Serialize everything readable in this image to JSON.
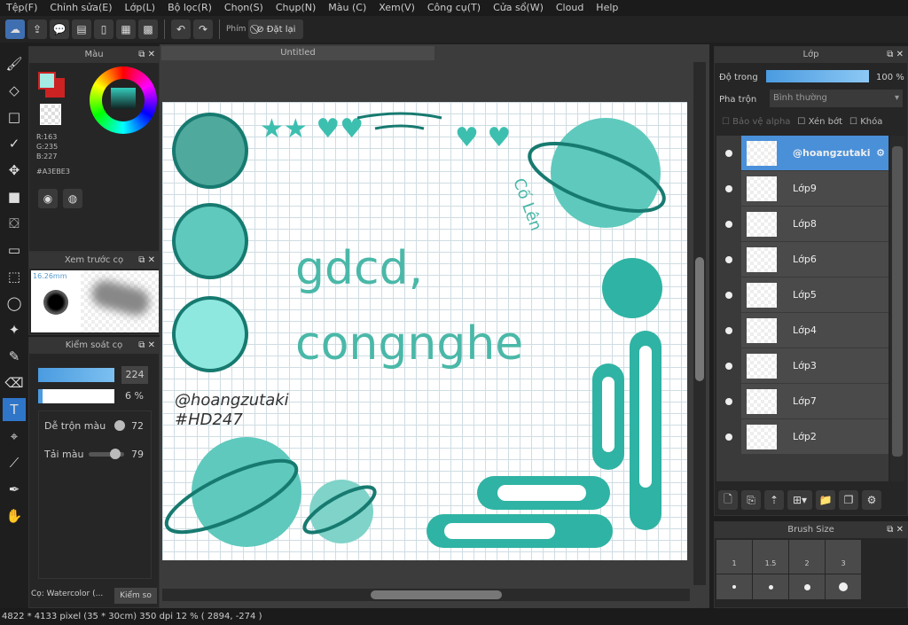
{
  "menu": [
    "Tệp(F)",
    "Chỉnh sửa(E)",
    "Lớp(L)",
    "Bộ lọc(R)",
    "Chọn(S)",
    "Chụp(N)",
    "Màu (C)",
    "Xem(V)",
    "Công cụ(T)",
    "Cửa sổ(W)",
    "Cloud",
    "Help"
  ],
  "toolbar": {
    "shortcut_label": "Phím",
    "reset_label": "Đặt lại"
  },
  "canvas": {
    "title": "Untitled",
    "text1": "gdcd,",
    "text2": "congnghe",
    "watermark1": "@hoangzutaki",
    "watermark2": "#HD247",
    "sticker": "Cố Lên"
  },
  "color_panel": {
    "title": "Màu",
    "r": "R:163",
    "g": "G:235",
    "b": "B:227",
    "hex": "#A3EBE3",
    "primary_color": "#A3EBE3",
    "secondary_color": "#cc2222"
  },
  "brush_preview": {
    "title": "Xem trước cọ",
    "size": "16.26mm"
  },
  "brush_control": {
    "title": "Kiểm soát cọ",
    "size_value": "224",
    "opacity_value": "6 %",
    "mix_label": "Dễ trộn màu",
    "mix_value": "72",
    "load_label": "Tải màu",
    "load_value": "79",
    "brush_name": "Cọ: Watercolor (...",
    "tab2": "Kiểm so"
  },
  "layers_panel": {
    "title": "Lớp",
    "opacity_label": "Độ trong",
    "opacity_value": "100 %",
    "blend_label": "Pha trộn",
    "blend_value": "Bình thường",
    "protect_alpha": "Bảo vệ alpha",
    "clipping": "Xén bớt",
    "lock": "Khóa",
    "layers": [
      {
        "name": "@hoangzutaki",
        "selected": true
      },
      {
        "name": "Lớp9"
      },
      {
        "name": "Lớp8"
      },
      {
        "name": "Lớp6"
      },
      {
        "name": "Lớp5"
      },
      {
        "name": "Lớp4"
      },
      {
        "name": "Lớp3"
      },
      {
        "name": "Lớp7"
      },
      {
        "name": "Lớp2"
      }
    ]
  },
  "brush_size": {
    "title": "Brush Size",
    "sizes": [
      "1",
      "1.5",
      "2",
      "3"
    ]
  },
  "status": "4822 * 4133 pixel  (35 * 30cm)  350 dpi  12 %  ( 2894, -274 )",
  "accent": "#4a90d9"
}
